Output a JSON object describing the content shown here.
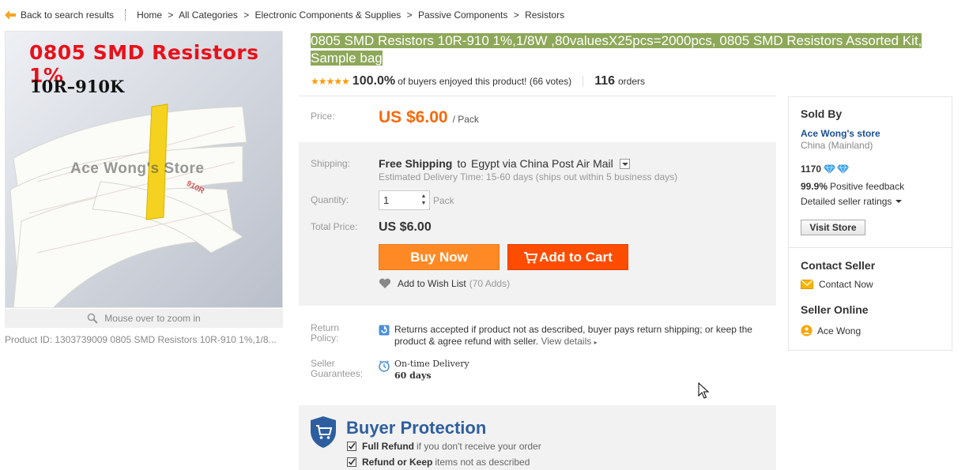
{
  "breadcrumb": {
    "back_label": "Back to search results",
    "trail": [
      "Home",
      "All Categories",
      "Electronic Components & Supplies",
      "Passive Components",
      "Resistors"
    ],
    "separator": ">"
  },
  "gallery": {
    "image_text_line1": "0805 SMD Resistors 1%",
    "image_text_line2": "10R–910K",
    "watermark": "Ace Wong's Store",
    "reel_text": "910R",
    "zoom_hint": "Mouse over to zoom in",
    "product_id": "Product ID: 1303739009 0805 SMD Resistors 10R-910 1%,1/8..."
  },
  "product": {
    "title": "0805 SMD Resistors 10R-910 1%,1/8W ,80valuesX25pcs=2000pcs, 0805 SMD Resistors Assorted Kit, Sample bag",
    "stars": "★★★★★",
    "rating_pct": "100.0%",
    "rating_text": "of buyers enjoyed this product! (66 votes)",
    "orders_count": "116",
    "orders_label": "orders"
  },
  "price": {
    "label": "Price:",
    "amount": "US $6.00",
    "unit": "/ Pack"
  },
  "shipping": {
    "label": "Shipping:",
    "method_bold": "Free Shipping",
    "to": "to",
    "destination": "Egypt via China Post Air Mail",
    "estimate": "Estimated Delivery Time: 15-60 days (ships out within 5 business days)"
  },
  "quantity": {
    "label": "Quantity:",
    "value": "1",
    "unit": "Pack"
  },
  "total": {
    "label": "Total Price:",
    "amount": "US $6.00"
  },
  "actions": {
    "buy_now": "Buy Now",
    "add_to_cart": "Add to Cart",
    "wishlist": "Add to Wish List",
    "wishlist_adds": "(70 Adds)"
  },
  "return_policy": {
    "label_line1": "Return",
    "label_line2": "Policy:",
    "text": "Returns accepted if product not as described, buyer pays return shipping; or keep the product & agree refund with seller.",
    "details_link": "View details"
  },
  "guarantees": {
    "label_line1": "Seller",
    "label_line2": "Guarantees:",
    "line1": "On-time Delivery",
    "line2": "60 days"
  },
  "buyer_protection": {
    "title": "Buyer Protection",
    "items": [
      {
        "bold": "Full Refund",
        "rest": "if you don't receive your order"
      },
      {
        "bold": "Refund or Keep",
        "rest": "items not as described"
      }
    ]
  },
  "seller": {
    "sold_by": "Sold By",
    "store_name": "Ace Wong's store",
    "country": "China (Mainland)",
    "score": "1170",
    "feedback_pct": "99.9%",
    "feedback_label": "Positive feedback",
    "detailed_ratings": "Detailed seller ratings",
    "visit_store": "Visit Store",
    "contact_heading": "Contact Seller",
    "contact_now": "Contact Now",
    "online_heading": "Seller Online",
    "online_user": "Ace Wong"
  },
  "colors": {
    "accent_orange": "#f6690a",
    "buy_now": "#ff8a25",
    "add_to_cart": "#ff4d00",
    "title_highlight": "#8ea859",
    "link_blue": "#1b4f94",
    "protection_blue": "#2d5fa0"
  }
}
